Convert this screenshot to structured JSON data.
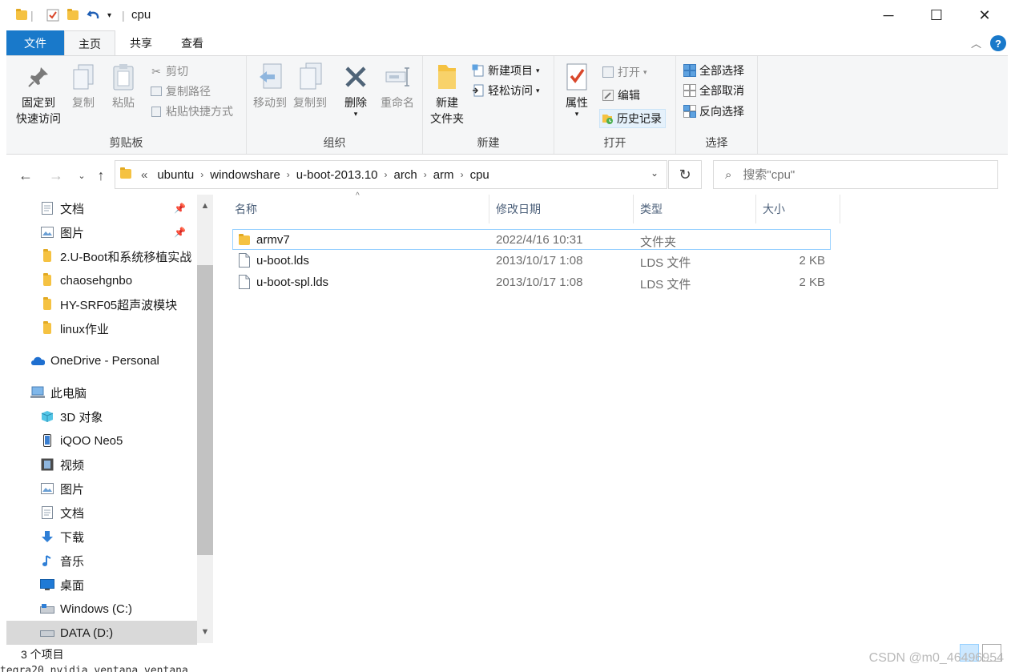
{
  "window": {
    "title": "cpu",
    "minimize": "─",
    "maximize": "☐",
    "close": "✕"
  },
  "tabs": {
    "file": "文件",
    "home": "主页",
    "share": "共享",
    "view": "查看"
  },
  "ribbon": {
    "clipboard": {
      "label": "剪贴板",
      "pin": "固定到\n快速访问",
      "pin_l1": "固定到",
      "pin_l2": "快速访问",
      "copy": "复制",
      "paste": "粘贴",
      "cut": "剪切",
      "copy_path": "复制路径",
      "paste_shortcut": "粘贴快捷方式"
    },
    "organize": {
      "label": "组织",
      "move_to": "移动到",
      "copy_to": "复制到",
      "delete": "删除",
      "rename": "重命名"
    },
    "new": {
      "label": "新建",
      "new_folder_l1": "新建",
      "new_folder_l2": "文件夹",
      "new_item": "新建项目",
      "easy_access": "轻松访问"
    },
    "open": {
      "label": "打开",
      "properties": "属性",
      "open": "打开",
      "edit": "编辑",
      "history": "历史记录"
    },
    "select": {
      "label": "选择",
      "select_all": "全部选择",
      "select_none": "全部取消",
      "invert": "反向选择"
    }
  },
  "address": {
    "overflow": "«",
    "crumbs": [
      "ubuntu",
      "windowshare",
      "u-boot-2013.10",
      "arch",
      "arm",
      "cpu"
    ]
  },
  "search": {
    "placeholder": "搜索\"cpu\""
  },
  "nav": {
    "quick": [
      {
        "label": "文档",
        "pinned": true
      },
      {
        "label": "图片",
        "pinned": true
      },
      {
        "label": "2.U-Boot和系统移植实战"
      },
      {
        "label": "chaosehgnbo"
      },
      {
        "label": "HY-SRF05超声波模块"
      },
      {
        "label": "linux作业"
      }
    ],
    "onedrive": "OneDrive - Personal",
    "thispc": "此电脑",
    "pc_items": [
      "3D 对象",
      "iQOO Neo5",
      "视频",
      "图片",
      "文档",
      "下载",
      "音乐",
      "桌面",
      "Windows (C:)",
      "DATA (D:)"
    ]
  },
  "columns": {
    "name": "名称",
    "date": "修改日期",
    "type": "类型",
    "size": "大小"
  },
  "files": [
    {
      "name": "armv7",
      "date": "2022/4/16 10:31",
      "type": "文件夹",
      "size": "",
      "kind": "folder"
    },
    {
      "name": "u-boot.lds",
      "date": "2013/10/17 1:08",
      "type": "LDS 文件",
      "size": "2 KB",
      "kind": "file"
    },
    {
      "name": "u-boot-spl.lds",
      "date": "2013/10/17 1:08",
      "type": "LDS 文件",
      "size": "2 KB",
      "kind": "file"
    }
  ],
  "status": {
    "count": "3 个项目"
  },
  "background_text": "tegra20     nvidia        ventana          ventana",
  "watermark": "CSDN @m0_46496954",
  "colors": {
    "accent": "#1979ca",
    "folder": "#f5c242",
    "selection_border": "#99d1ff"
  }
}
